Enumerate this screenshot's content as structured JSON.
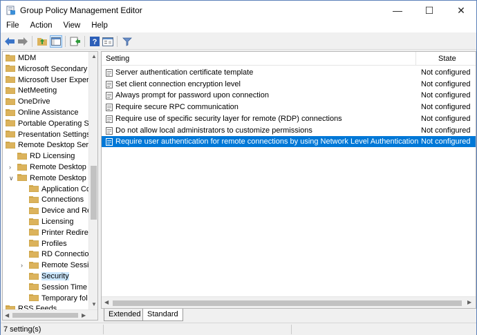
{
  "window": {
    "title": "Group Policy Management Editor",
    "minimize_glyph": "—",
    "maximize_glyph": "☐",
    "close_glyph": "✕"
  },
  "menu": [
    "File",
    "Action",
    "View",
    "Help"
  ],
  "toolbar": {
    "icons": [
      "back-arrow-icon",
      "forward-arrow-icon",
      "up-folder-icon",
      "show-hide-tree-icon",
      "export-list-icon",
      "help-icon",
      "properties-icon",
      "filter-icon"
    ]
  },
  "tree": {
    "items": [
      {
        "label": "MDM",
        "level": 0,
        "expander": ""
      },
      {
        "label": "Microsoft Secondary A",
        "level": 0,
        "expander": ""
      },
      {
        "label": "Microsoft User Experie",
        "level": 0,
        "expander": ""
      },
      {
        "label": "NetMeeting",
        "level": 0,
        "expander": ""
      },
      {
        "label": "OneDrive",
        "level": 0,
        "expander": ""
      },
      {
        "label": "Online Assistance",
        "level": 0,
        "expander": ""
      },
      {
        "label": "Portable Operating Sy",
        "level": 0,
        "expander": ""
      },
      {
        "label": "Presentation Settings",
        "level": 0,
        "expander": ""
      },
      {
        "label": "Remote Desktop Servi",
        "level": 0,
        "expander": "expanded"
      },
      {
        "label": "RD Licensing",
        "level": 1,
        "expander": ""
      },
      {
        "label": "Remote Desktop C",
        "level": 1,
        "expander": "collapsed"
      },
      {
        "label": "Remote Desktop S",
        "level": 1,
        "expander": "expanded"
      },
      {
        "label": "Application Co",
        "level": 2,
        "expander": ""
      },
      {
        "label": "Connections",
        "level": 2,
        "expander": ""
      },
      {
        "label": "Device and Res",
        "level": 2,
        "expander": ""
      },
      {
        "label": "Licensing",
        "level": 2,
        "expander": ""
      },
      {
        "label": "Printer Redirec",
        "level": 2,
        "expander": ""
      },
      {
        "label": "Profiles",
        "level": 2,
        "expander": ""
      },
      {
        "label": "RD Connection",
        "level": 2,
        "expander": ""
      },
      {
        "label": "Remote Sessio",
        "level": 2,
        "expander": "collapsed"
      },
      {
        "label": "Security",
        "level": 2,
        "expander": "",
        "selected": true
      },
      {
        "label": "Session Time L",
        "level": 2,
        "expander": ""
      },
      {
        "label": "Temporary fol",
        "level": 2,
        "expander": ""
      },
      {
        "label": "RSS Feeds",
        "level": 0,
        "expander": ""
      }
    ]
  },
  "list": {
    "header_setting": "Setting",
    "header_state": "State",
    "rows": [
      {
        "name": "Server authentication certificate template",
        "state": "Not configured"
      },
      {
        "name": "Set client connection encryption level",
        "state": "Not configured"
      },
      {
        "name": "Always prompt for password upon connection",
        "state": "Not configured"
      },
      {
        "name": "Require secure RPC communication",
        "state": "Not configured"
      },
      {
        "name": "Require use of specific security layer for remote (RDP) connections",
        "state": "Not configured"
      },
      {
        "name": "Do not allow local administrators to customize permissions",
        "state": "Not configured"
      },
      {
        "name": "Require user authentication for remote connections by using Network Level Authentication",
        "state": "Not configured",
        "selected": true
      }
    ]
  },
  "tabs": {
    "extended": "Extended",
    "standard": "Standard",
    "active": "Standard"
  },
  "status": {
    "text": "7 setting(s)"
  },
  "colors": {
    "selection": "#0078d7",
    "tree_selection": "#cce8ff",
    "folder": "#dcb35c"
  }
}
